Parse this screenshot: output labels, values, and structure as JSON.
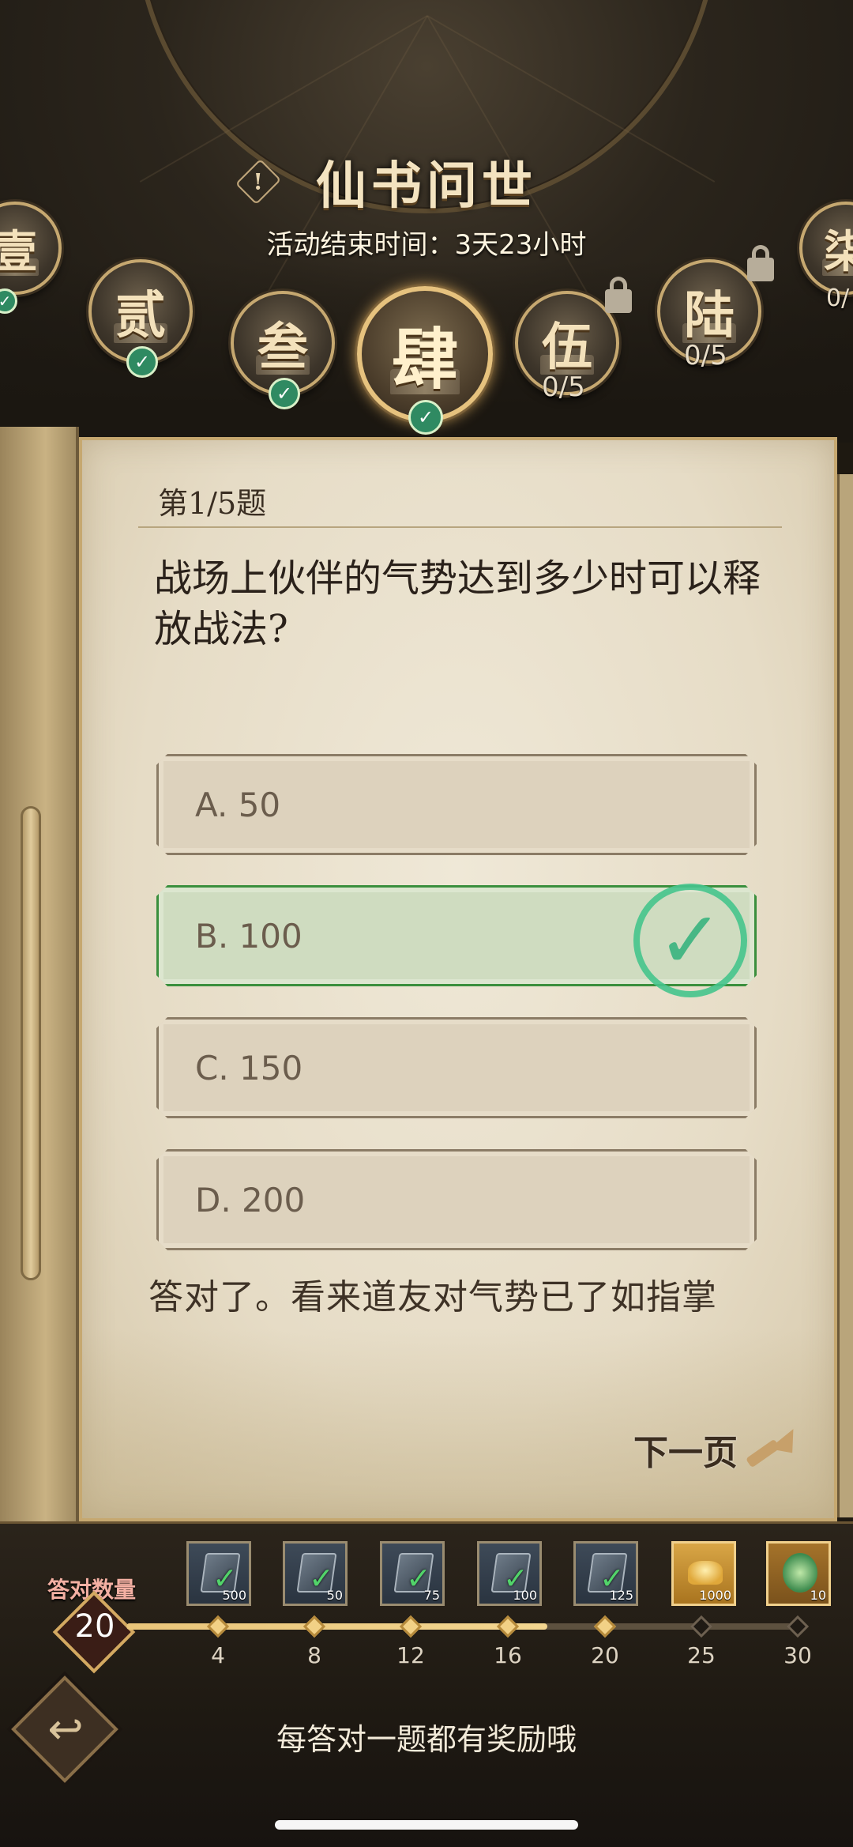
{
  "header": {
    "title": "仙书问世",
    "alert_icon": "!",
    "end_time_label": "活动结束时间：3天23小时"
  },
  "chapters": [
    {
      "glyph": "壹",
      "status": "completed"
    },
    {
      "glyph": "贰",
      "status": "completed"
    },
    {
      "glyph": "叁",
      "status": "completed"
    },
    {
      "glyph": "肆",
      "status": "active-completed"
    },
    {
      "glyph": "伍",
      "status": "in-progress",
      "progress": "0/5"
    },
    {
      "glyph": "陆",
      "status": "locked",
      "progress": "0/5"
    },
    {
      "glyph": "柒",
      "status": "locked",
      "progress": "0/"
    }
  ],
  "question": {
    "index_label": "第1/5题",
    "text": "战场上伙伴的气势达到多少时可以释放战法?",
    "options": [
      {
        "label": "A. 50",
        "state": "normal"
      },
      {
        "label": "B. 100",
        "state": "correct"
      },
      {
        "label": "C. 150",
        "state": "normal"
      },
      {
        "label": "D. 200",
        "state": "normal"
      }
    ],
    "feedback": "答对了。看来道友对气势已了如指掌",
    "next_label": "下一页"
  },
  "rewards": {
    "count_label": "答对数量",
    "count_value": "20",
    "progress_fraction": 0.62,
    "milestones": [
      "4",
      "8",
      "12",
      "16",
      "20",
      "25",
      "30"
    ],
    "items": [
      {
        "icon": "book-scroll-icon",
        "qty": "500",
        "claimed": true
      },
      {
        "icon": "skill-book-icon",
        "qty": "50",
        "claimed": true
      },
      {
        "icon": "skill-book-icon",
        "qty": "75",
        "claimed": true
      },
      {
        "icon": "skill-book-icon",
        "qty": "100",
        "claimed": true
      },
      {
        "icon": "skill-book-icon",
        "qty": "125",
        "claimed": true
      },
      {
        "icon": "gold-ingot-icon",
        "qty": "1000",
        "claimed": false
      },
      {
        "icon": "jade-dragon-icon",
        "qty": "10",
        "claimed": false
      }
    ],
    "hint": "每答对一题都有奖励哦"
  },
  "colors": {
    "accent_gold": "#e6c27e",
    "correct_green": "#3a8f3d",
    "check_green": "#39b47f"
  }
}
